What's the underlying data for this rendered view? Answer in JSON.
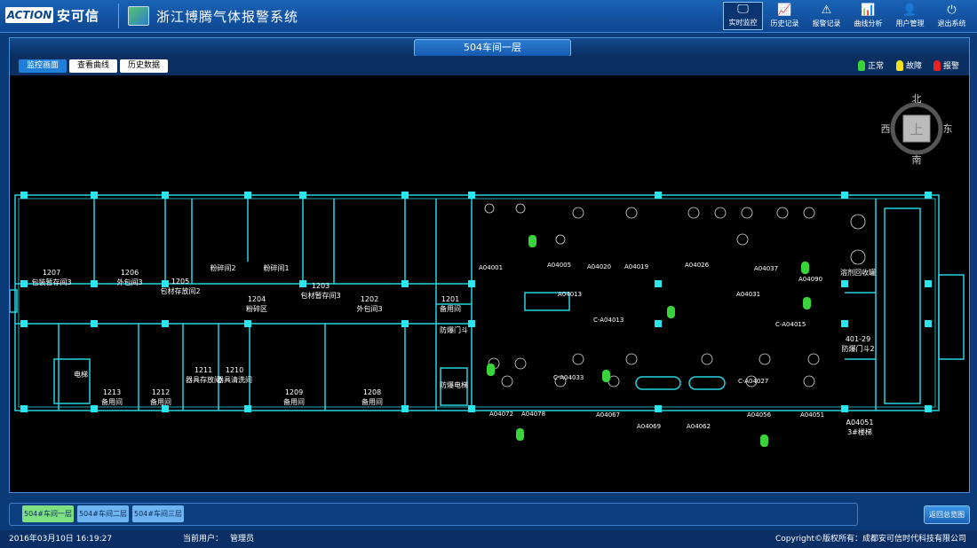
{
  "header": {
    "logo_text": "安可信",
    "logo_badge": "ACTION",
    "app_title": "浙江博腾气体报警系统",
    "nav": [
      {
        "label": "实时监控",
        "icon": "monitor-icon",
        "glyph": "🖵",
        "active": true
      },
      {
        "label": "历史记录",
        "icon": "chart-line-icon",
        "glyph": "📈",
        "active": false
      },
      {
        "label": "报警记录",
        "icon": "warning-icon",
        "glyph": "⚠",
        "active": false
      },
      {
        "label": "曲线分析",
        "icon": "analysis-icon",
        "glyph": "📊",
        "active": false
      },
      {
        "label": "用户管理",
        "icon": "user-icon",
        "glyph": "👤",
        "active": false
      },
      {
        "label": "退出系统",
        "icon": "power-icon",
        "glyph": "⏻",
        "active": false
      }
    ]
  },
  "floor_title": "504车间一层",
  "tabs": [
    {
      "label": "监控画面",
      "active": true
    },
    {
      "label": "查看曲线",
      "active": false
    },
    {
      "label": "历史数据",
      "active": false
    }
  ],
  "legend": [
    {
      "label": "正常",
      "color": "#39d439"
    },
    {
      "label": "故障",
      "color": "#f2e01a"
    },
    {
      "label": "报警",
      "color": "#e82020"
    }
  ],
  "compass": {
    "north": "北",
    "south": "南",
    "east": "东",
    "west": "西",
    "center": "上"
  },
  "rooms": [
    {
      "number": "1207",
      "name": "包装暂存间3"
    },
    {
      "number": "1206",
      "name": "外包间3"
    },
    {
      "number": "1205",
      "name": "包材存放间2"
    },
    {
      "number": "",
      "name": "粉碎间2"
    },
    {
      "number": "",
      "name": "粉碎间1"
    },
    {
      "number": "1204",
      "name": "粉碎区"
    },
    {
      "number": "1203",
      "name": "包材暂存间3"
    },
    {
      "number": "1202",
      "name": "外包间3"
    },
    {
      "number": "1201",
      "name": "备用间"
    },
    {
      "number": "",
      "name": "防爆门斗"
    },
    {
      "number": "",
      "name": "电梯"
    },
    {
      "number": "1213",
      "name": "备用间"
    },
    {
      "number": "1212",
      "name": "备用间"
    },
    {
      "number": "1211",
      "name": "器具存放间"
    },
    {
      "number": "1210",
      "name": "器具清洗间"
    },
    {
      "number": "1209",
      "name": "备用间"
    },
    {
      "number": "1208",
      "name": "备用间"
    },
    {
      "number": "",
      "name": "防爆电梯"
    },
    {
      "number": "",
      "name": "溶剂回收罐"
    },
    {
      "number": "401-29",
      "name": "防爆门斗2"
    },
    {
      "number": "A04051",
      "name": "3#楼梯"
    }
  ],
  "equipment_labels": [
    "A04001",
    "A04005",
    "A04020",
    "A04019",
    "A04026",
    "A04037",
    "A04090",
    "A04013",
    "C-A04013",
    "A04031",
    "C-A04015",
    "C-A04033",
    "C-A04027",
    "A04072",
    "A04078",
    "A04067",
    "A04069",
    "A04062",
    "A04056",
    "A04051"
  ],
  "floor_buttons": [
    {
      "label": "504#车间一层",
      "active": true
    },
    {
      "label": "504#车间二层",
      "active": false
    },
    {
      "label": "504#车间三层",
      "active": false
    }
  ],
  "return_label": "返回总览图",
  "status": {
    "datetime": "2016年03月10日 16:19:27",
    "user_label": "当前用户：",
    "user_name": "管理员",
    "copyright": "Copyright©版权所有：成都安可信时代科技有限公司"
  }
}
